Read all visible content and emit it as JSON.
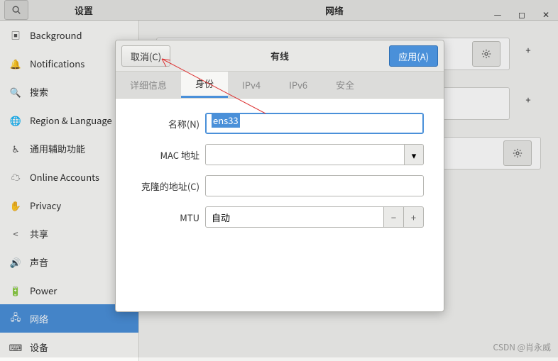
{
  "titlebar": {
    "settings_label": "设置",
    "center_title": "网络"
  },
  "sidebar": {
    "items": [
      {
        "label": "Background",
        "icon": "background-icon"
      },
      {
        "label": "Notifications",
        "icon": "bell-icon"
      },
      {
        "label": "搜索",
        "icon": "search-icon"
      },
      {
        "label": "Region & Language",
        "icon": "region-icon"
      },
      {
        "label": "通用辅助功能",
        "icon": "accessibility-icon"
      },
      {
        "label": "Online Accounts",
        "icon": "online-accounts-icon"
      },
      {
        "label": "Privacy",
        "icon": "privacy-icon"
      },
      {
        "label": "共享",
        "icon": "share-icon"
      },
      {
        "label": "声音",
        "icon": "sound-icon"
      },
      {
        "label": "Power",
        "icon": "power-icon"
      },
      {
        "label": "网络",
        "icon": "network-icon",
        "selected": true
      },
      {
        "label": "设备",
        "icon": "devices-icon"
      }
    ]
  },
  "dialog": {
    "cancel_label": "取消(C)",
    "apply_label": "应用(A)",
    "title": "有线",
    "tabs": [
      {
        "label": "详细信息"
      },
      {
        "label": "身份",
        "active": true
      },
      {
        "label": "IPv4"
      },
      {
        "label": "IPv6"
      },
      {
        "label": "安全"
      }
    ],
    "form": {
      "name_label": "名称(N)",
      "name_value": "ens33",
      "mac_label": "MAC 地址",
      "mac_value": "",
      "cloned_mac_label": "克隆的地址(C)",
      "cloned_mac_value": "",
      "mtu_label": "MTU",
      "mtu_value": "自动"
    }
  },
  "watermark": "CSDN @肖永威"
}
